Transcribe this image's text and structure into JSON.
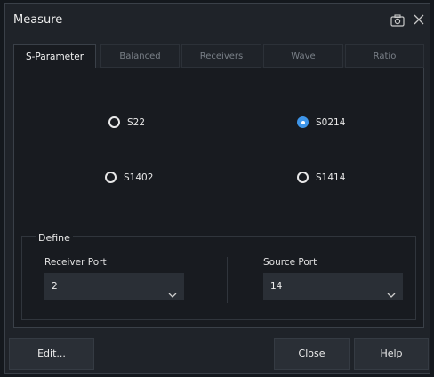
{
  "window": {
    "title": "Measure"
  },
  "icons": {
    "camera": "camera-icon",
    "close": "close-icon",
    "chevron": "chevron-down-icon"
  },
  "colors": {
    "accent": "#3e95e8",
    "background": "#1f2329",
    "panel": "#181b20"
  },
  "tabs": [
    {
      "label": "S-Parameter",
      "active": true
    },
    {
      "label": "Balanced",
      "active": false
    },
    {
      "label": "Receivers",
      "active": false
    },
    {
      "label": "Wave",
      "active": false
    },
    {
      "label": "Ratio",
      "active": false
    }
  ],
  "parameters": [
    {
      "label": "S22",
      "selected": false
    },
    {
      "label": "S0214",
      "selected": true
    },
    {
      "label": "S1402",
      "selected": false
    },
    {
      "label": "S1414",
      "selected": false
    }
  ],
  "define": {
    "title": "Define",
    "receiver_port": {
      "label": "Receiver Port",
      "value": "2"
    },
    "source_port": {
      "label": "Source Port",
      "value": "14"
    }
  },
  "buttons": {
    "edit": "Edit...",
    "close": "Close",
    "help": "Help"
  }
}
